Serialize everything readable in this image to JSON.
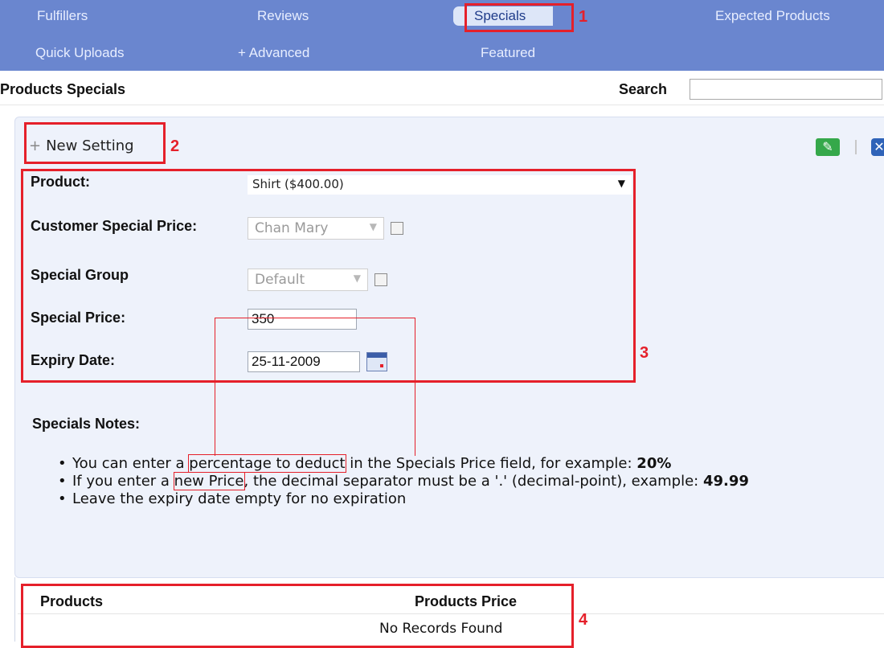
{
  "nav": {
    "items": [
      {
        "label": "Fulfillers"
      },
      {
        "label": "Reviews"
      },
      {
        "label": "Specials",
        "active": true
      },
      {
        "label": "Expected Products"
      },
      {
        "label": "Quick Uploads"
      },
      {
        "label": "+ Advanced"
      },
      {
        "label": "Featured"
      }
    ]
  },
  "header": {
    "title": "Products Specials",
    "search_label": "Search",
    "search_value": ""
  },
  "form": {
    "new_setting": "New Setting",
    "product_label": "Product:",
    "product_value": "Shirt ($400.00)",
    "customer_special_price_label": "Customer Special Price:",
    "customer_value": "Chan Mary",
    "special_group_label": "Special Group",
    "special_group_value": "Default",
    "special_price_label": "Special Price:",
    "special_price_value": "350",
    "expiry_date_label": "Expiry Date:",
    "expiry_date_value": "25-11-2009"
  },
  "notes": {
    "title": "Specials Notes:",
    "item1_pre": "You can enter a ",
    "item1_highlight": "percentage to deduct",
    "item1_post": " in the Specials Price field, for example: ",
    "item1_bold": "20%",
    "item2_pre": "If you enter a ",
    "item2_highlight": "new Price",
    "item2_post": ", the decimal separator must be a '.' (decimal-point), example: ",
    "item2_bold": "49.99",
    "item3": "Leave the expiry date empty for no expiration"
  },
  "table": {
    "col_products": "Products",
    "col_price": "Products Price",
    "empty_message": "No Records Found"
  },
  "annotations": {
    "n1": "1",
    "n2": "2",
    "n3": "3",
    "n4": "4"
  },
  "colors": {
    "nav_bg": "#6a86cf",
    "panel_bg": "#eef2fb",
    "annotation_red": "#e5202a"
  },
  "icons": {
    "edit": "edit-icon",
    "close": "close-icon",
    "calendar": "calendar-icon"
  }
}
